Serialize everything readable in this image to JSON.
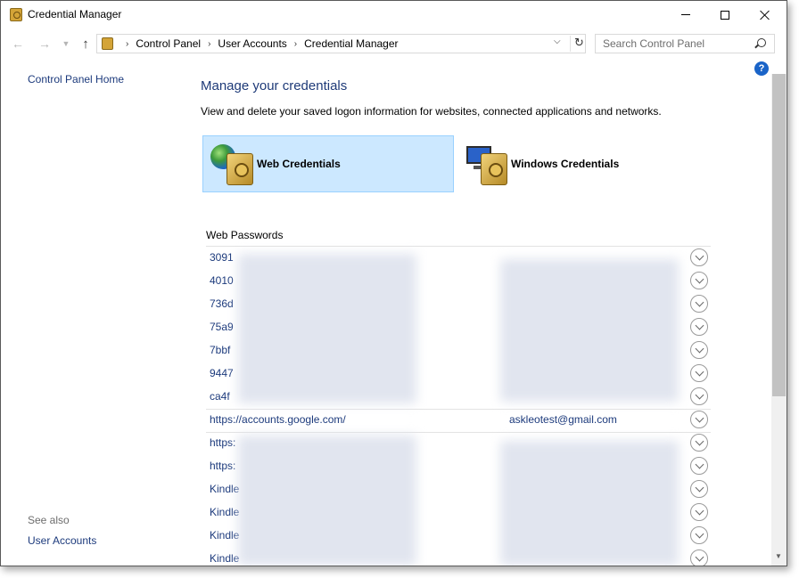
{
  "window": {
    "title": "Credential Manager"
  },
  "address": {
    "crumbs": [
      "Control Panel",
      "User Accounts",
      "Credential Manager"
    ],
    "search_placeholder": "Search Control Panel"
  },
  "leftnav": {
    "home_label": "Control Panel Home",
    "see_also": "See also",
    "user_accounts": "User Accounts"
  },
  "main": {
    "title": "Manage your credentials",
    "description": "View and delete your saved logon information for websites, connected applications and networks.",
    "tiles": [
      {
        "label": "Web Credentials",
        "selected": true
      },
      {
        "label": "Windows Credentials",
        "selected": false
      }
    ],
    "section_title": "Web Passwords",
    "rows": [
      {
        "title": "3091",
        "user": ""
      },
      {
        "title": "4010",
        "user": ""
      },
      {
        "title": "736d",
        "user": ""
      },
      {
        "title": "75a9",
        "user": ""
      },
      {
        "title": "7bbf",
        "user": ""
      },
      {
        "title": "9447",
        "user": ""
      },
      {
        "title": "ca4f",
        "user": ""
      },
      {
        "title": "https://accounts.google.com/",
        "user": "askleotest@gmail.com"
      },
      {
        "title": "https:",
        "user": ""
      },
      {
        "title": "https:",
        "user": ""
      },
      {
        "title": "Kindle",
        "user": ""
      },
      {
        "title": "Kindle",
        "user": ""
      },
      {
        "title": "Kindle",
        "user": ""
      },
      {
        "title": "Kindle",
        "user": ""
      }
    ]
  },
  "colors": {
    "link": "#1c3a7c",
    "title_blue": "#1e3a78",
    "selected_tile": "#cce8ff"
  }
}
